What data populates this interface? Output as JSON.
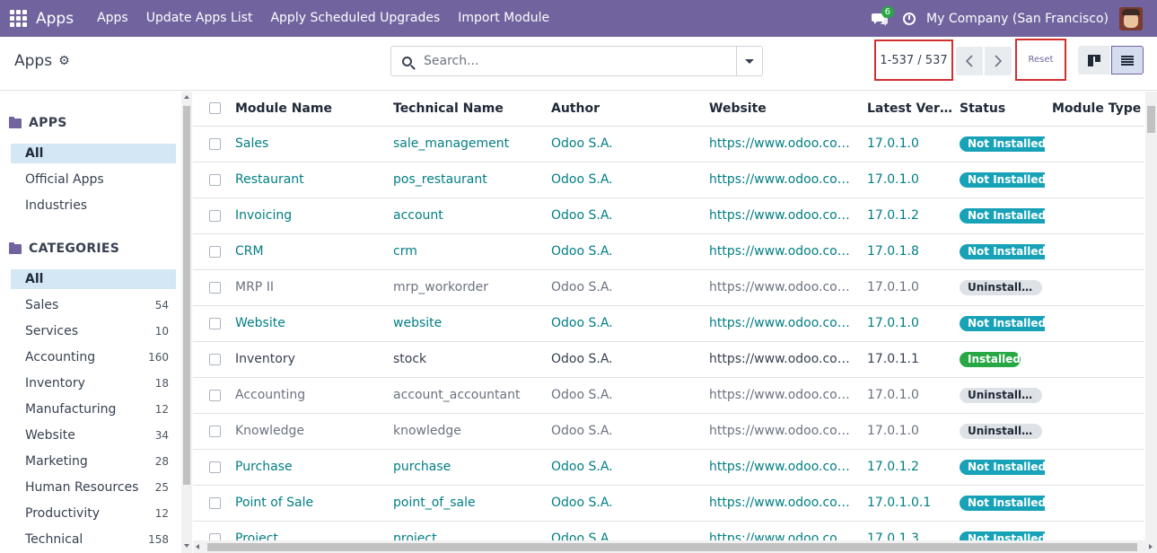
{
  "navbar": {
    "brand": "Apps",
    "menu": [
      "Apps",
      "Update Apps List",
      "Apply Scheduled Upgrades",
      "Import Module"
    ],
    "chat_badge": "6",
    "company": "My Company (San Francisco)"
  },
  "control": {
    "breadcrumb": "Apps",
    "search_placeholder": "Search...",
    "pager": "1-537 / 537",
    "reset_label": "Reset"
  },
  "sidebar": {
    "apps_title": "APPS",
    "apps_items": [
      "All",
      "Official Apps",
      "Industries"
    ],
    "categories_title": "CATEGORIES",
    "categories": [
      {
        "label": "All",
        "count": ""
      },
      {
        "label": "Sales",
        "count": "54"
      },
      {
        "label": "Services",
        "count": "10"
      },
      {
        "label": "Accounting",
        "count": "160"
      },
      {
        "label": "Inventory",
        "count": "18"
      },
      {
        "label": "Manufacturing",
        "count": "12"
      },
      {
        "label": "Website",
        "count": "34"
      },
      {
        "label": "Marketing",
        "count": "28"
      },
      {
        "label": "Human Resources",
        "count": "25"
      },
      {
        "label": "Productivity",
        "count": "12"
      },
      {
        "label": "Technical",
        "count": "158"
      }
    ]
  },
  "table": {
    "headers": [
      "Module Name",
      "Technical Name",
      "Author",
      "Website",
      "Latest Version",
      "Status",
      "Module Type"
    ],
    "rows": [
      {
        "name": "Sales",
        "tech": "sale_management",
        "author": "Odoo S.A.",
        "website": "https://www.odoo.com/app/sales",
        "version": "17.0.1.0",
        "status": "Not Installed",
        "state": "not",
        "style": "link"
      },
      {
        "name": "Restaurant",
        "tech": "pos_restaurant",
        "author": "Odoo S.A.",
        "website": "https://www.odoo.com/app/point-of-sale-restaurant",
        "version": "17.0.1.0",
        "status": "Not Installed",
        "state": "not",
        "style": "link"
      },
      {
        "name": "Invoicing",
        "tech": "account",
        "author": "Odoo S.A.",
        "website": "https://www.odoo.com/app/invoicing",
        "version": "17.0.1.2",
        "status": "Not Installed",
        "state": "not",
        "style": "link"
      },
      {
        "name": "CRM",
        "tech": "crm",
        "author": "Odoo S.A.",
        "website": "https://www.odoo.com/app/crm",
        "version": "17.0.1.8",
        "status": "Not Installed",
        "state": "not",
        "style": "link"
      },
      {
        "name": "MRP II",
        "tech": "mrp_workorder",
        "author": "Odoo S.A.",
        "website": "https://www.odoo.com/app/manufacturing",
        "version": "17.0.1.0",
        "status": "Uninstallable",
        "state": "uninst",
        "style": "muted"
      },
      {
        "name": "Website",
        "tech": "website",
        "author": "Odoo S.A.",
        "website": "https://www.odoo.com/app/website",
        "version": "17.0.1.0",
        "status": "Not Installed",
        "state": "not",
        "style": "link"
      },
      {
        "name": "Inventory",
        "tech": "stock",
        "author": "Odoo S.A.",
        "website": "https://www.odoo.com/app/inventory",
        "version": "17.0.1.1",
        "status": "Installed",
        "state": "inst",
        "style": "plain"
      },
      {
        "name": "Accounting",
        "tech": "account_accountant",
        "author": "Odoo S.A.",
        "website": "https://www.odoo.com/app/accounting",
        "version": "17.0.1.0",
        "status": "Uninstallable",
        "state": "uninst",
        "style": "muted"
      },
      {
        "name": "Knowledge",
        "tech": "knowledge",
        "author": "Odoo S.A.",
        "website": "https://www.odoo.com/app/knowledge",
        "version": "17.0.1.0",
        "status": "Uninstallable",
        "state": "uninst",
        "style": "muted"
      },
      {
        "name": "Purchase",
        "tech": "purchase",
        "author": "Odoo S.A.",
        "website": "https://www.odoo.com/app/purchase",
        "version": "17.0.1.2",
        "status": "Not Installed",
        "state": "not",
        "style": "link"
      },
      {
        "name": "Point of Sale",
        "tech": "point_of_sale",
        "author": "Odoo S.A.",
        "website": "https://www.odoo.com/app/point-of-sale-shop",
        "version": "17.0.1.0.1",
        "status": "Not Installed",
        "state": "not",
        "style": "link"
      },
      {
        "name": "Project",
        "tech": "project",
        "author": "Odoo S.A.",
        "website": "https://www.odoo.com/app/project",
        "version": "17.0.1.3",
        "status": "Not Installed",
        "state": "not",
        "style": "link"
      }
    ]
  },
  "colors": {
    "navbar": "#71639e",
    "link": "#017e84",
    "not_installed": "#17a2b8",
    "installed": "#28a745",
    "highlight_box": "#d32f2f"
  }
}
